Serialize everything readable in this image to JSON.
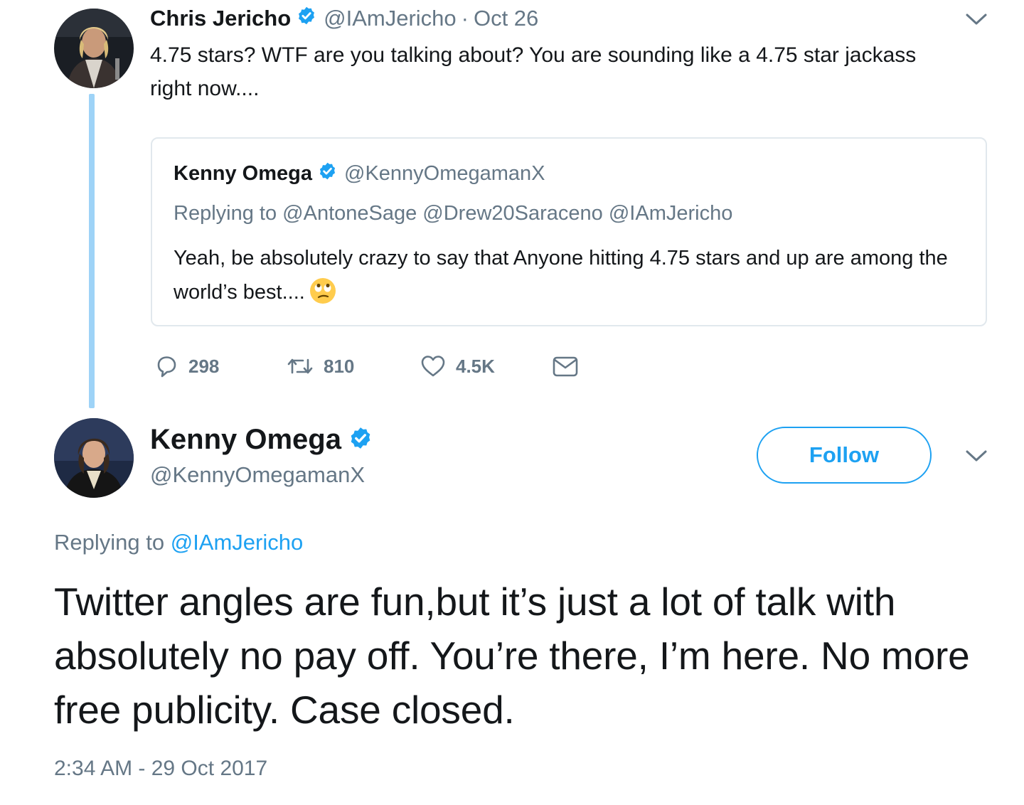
{
  "colors": {
    "accent": "#1da1f2",
    "muted": "#657786",
    "text": "#14171a",
    "thread_line": "#9ed3f7",
    "card_border": "#e1e8ed"
  },
  "parent_tweet": {
    "author_name": "Chris Jericho",
    "handle": "@IAmJericho",
    "separator": "·",
    "date": "Oct 26",
    "text": "4.75 stars? WTF are you talking about?  You are sounding like a 4.75 star jackass right now....",
    "quoted_tweet": {
      "author_name": "Kenny Omega",
      "handle": "@KennyOmegamanX",
      "replying_prefix": "Replying to",
      "replying_to": "@AntoneSage @Drew20Saraceno @IAmJericho",
      "text": "Yeah, be absolutely crazy to say that Anyone hitting 4.75 stars and up are among the world’s best....",
      "emoji": "face-with-rolling-eyes"
    },
    "actions": {
      "replies": "298",
      "retweets": "810",
      "likes": "4.5K"
    }
  },
  "main_tweet": {
    "author_name": "Kenny Omega",
    "handle": "@KennyOmegamanX",
    "follow_label": "Follow",
    "replying_prefix": "Replying to",
    "replying_to": "@IAmJericho",
    "text": "Twitter angles are fun,but it’s just a lot of talk with absolutely no pay off. You’re there, I’m here. No more free publicity. Case closed.",
    "timestamp": "2:34 AM - 29 Oct 2017"
  }
}
